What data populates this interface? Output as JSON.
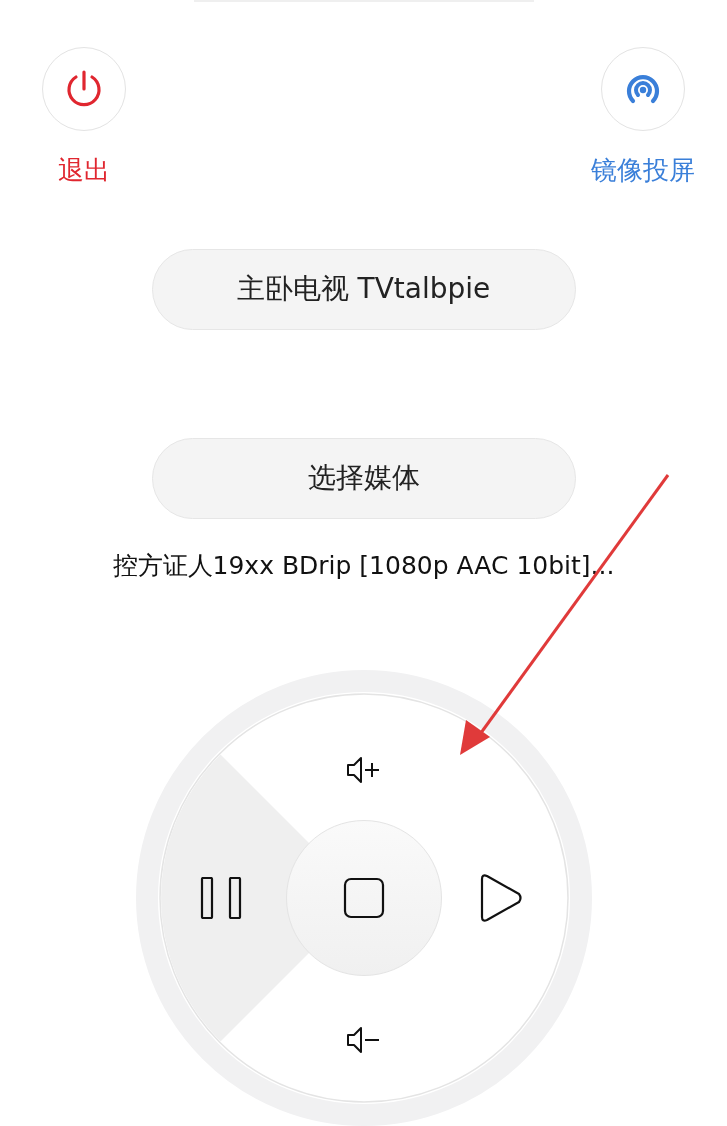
{
  "top_actions": [
    {
      "kind": "power",
      "label": "退出",
      "color": "#e0262f"
    },
    {
      "kind": "cast",
      "label": "镜像投屏",
      "color": "#3a7fd9"
    }
  ],
  "device_button": "主卧电视 TVtalbpie",
  "media_button": "选择媒体",
  "media_title": "控方证人19xx BDrip [1080p AAC 10bit]...",
  "remote": [
    {
      "kind": "vol_up",
      "selected": false
    },
    {
      "kind": "pause",
      "selected": true
    },
    {
      "kind": "play",
      "selected": false
    },
    {
      "kind": "vol_down",
      "selected": false
    },
    {
      "kind": "stop",
      "selected": false
    }
  ]
}
